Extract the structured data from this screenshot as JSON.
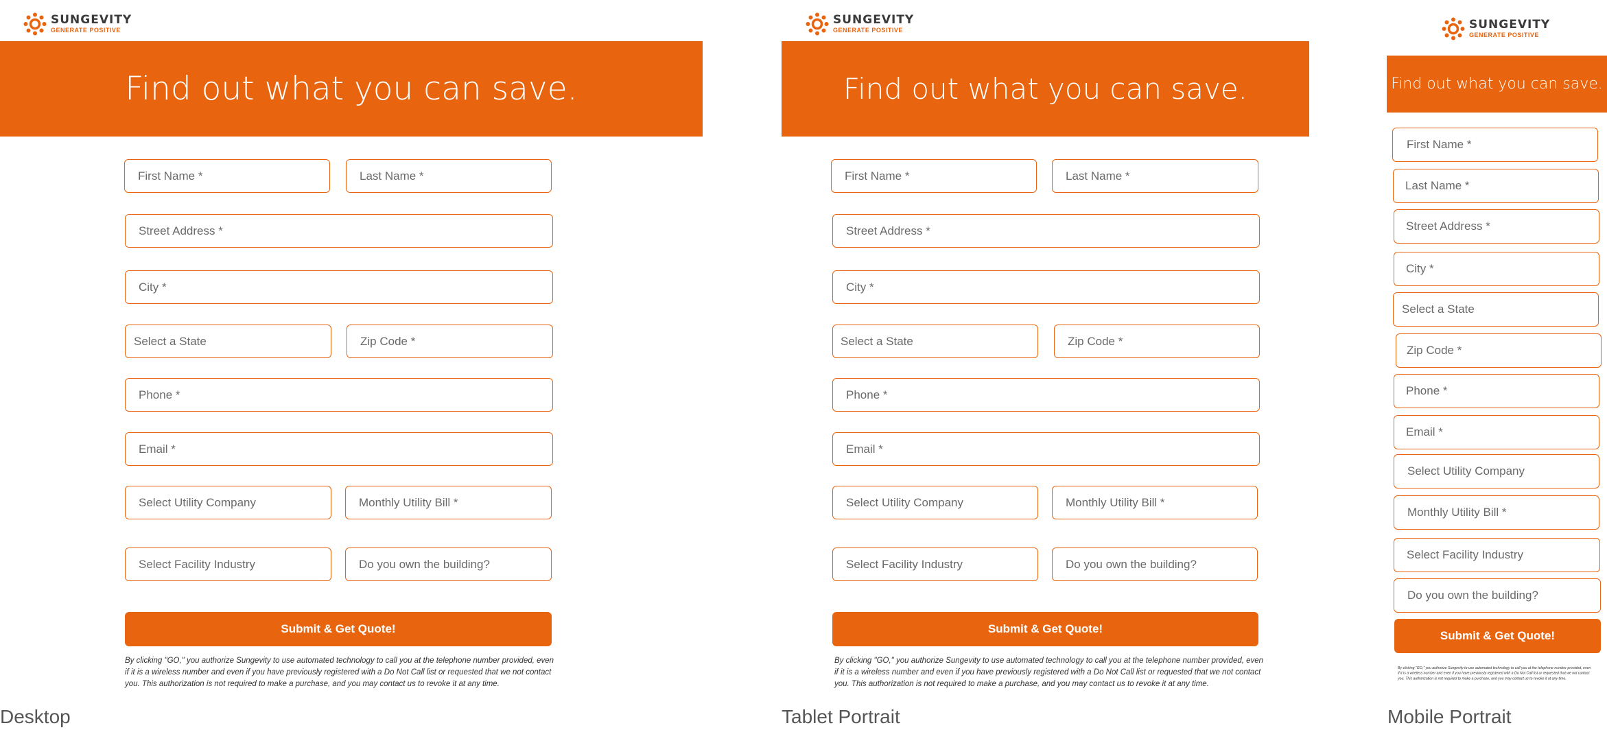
{
  "brand": {
    "name": "SUNGEVITY",
    "tagline": "GENERATE POSITIVE",
    "color": "#e8640e",
    "icon": "sun-icon"
  },
  "headline": "Find out what you can save.",
  "fields": {
    "first_name": "First Name *",
    "last_name": "Last Name *",
    "street": "Street Address *",
    "city": "City *",
    "state": "Select a State",
    "zip": "Zip Code *",
    "phone": "Phone *",
    "email": "Email *",
    "utility": "Select Utility Company",
    "bill": "Monthly Utility Bill *",
    "industry": "Select Facility Industry",
    "own": "Do you own the building?"
  },
  "submit_label": "Submit & Get Quote!",
  "disclaimer": "By clicking \"GO,\" you authorize Sungevity to use automated technology to call you at the telephone number provided, even if it is a wireless number and even if you have previously registered with a Do Not Call list or requested that we not contact you. This authorization is not required to make a purchase, and you may contact us to revoke it at any time.",
  "captions": {
    "desktop": "Desktop",
    "tablet": "Tablet Portrait",
    "mobile": "Mobile Portrait"
  }
}
